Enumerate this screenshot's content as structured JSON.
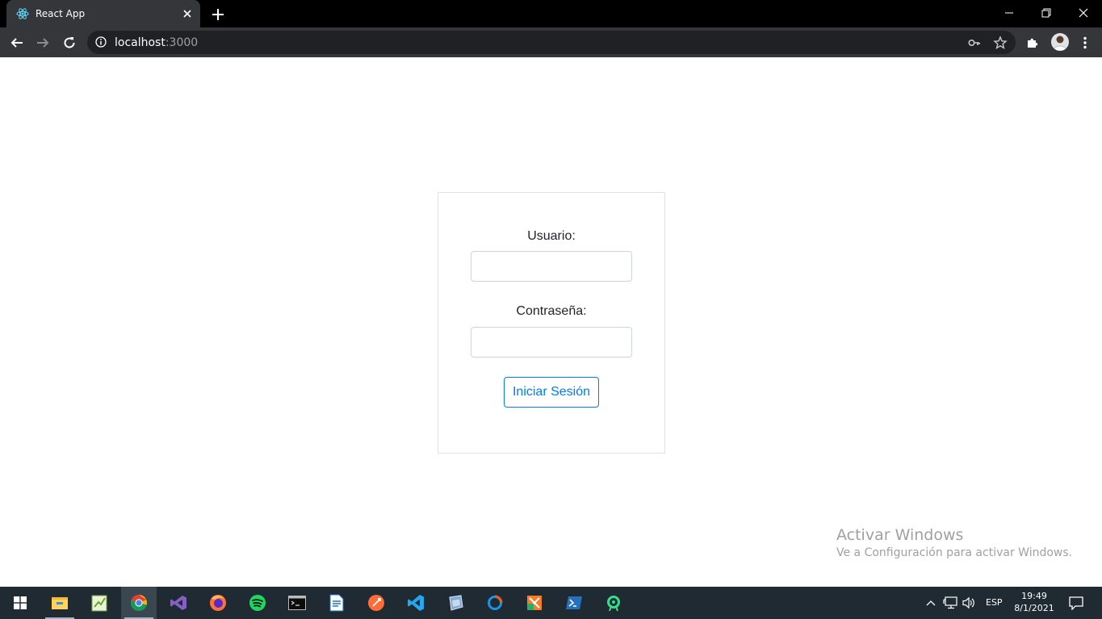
{
  "browser": {
    "tab_title": "React App",
    "url_host": "localhost",
    "url_port": ":3000"
  },
  "login": {
    "username_label": "Usuario:",
    "username_value": "",
    "password_label": "Contraseña:",
    "password_value": "",
    "submit_label": "Iniciar Sesión"
  },
  "watermark": {
    "title": "Activar Windows",
    "subtitle": "Ve a Configuración para activar Windows."
  },
  "taskbar": {
    "apps": [
      "file-explorer-icon",
      "notepad-plus-icon",
      "chrome-icon",
      "visual-studio-icon",
      "firefox-icon",
      "spotify-icon",
      "terminal-icon",
      "document-icon",
      "postman-icon",
      "vscode-icon",
      "virtualbox-icon",
      "git-icon",
      "xampp-icon",
      "powershell-icon",
      "android-studio-icon"
    ],
    "language": "ESP",
    "time": "19:49",
    "date": "8/1/2021"
  },
  "colors": {
    "accent": "#007bff",
    "chrome_bg": "#35363a",
    "taskbar_bg": "#1f2a33"
  }
}
